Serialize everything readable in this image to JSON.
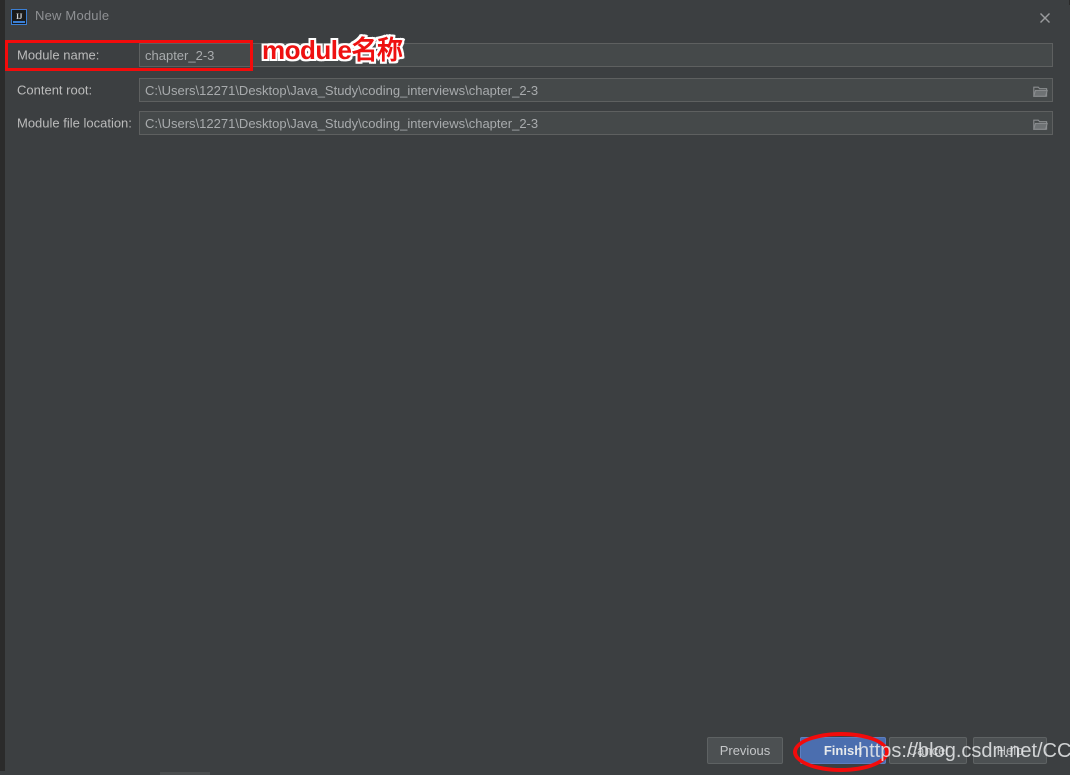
{
  "window": {
    "title": "New Module",
    "app_icon": "intellij-idea-icon",
    "icon_label": "IJ",
    "close_icon": "close-icon"
  },
  "form": {
    "fields": [
      {
        "label": "Module name:",
        "value": "chapter_2-3",
        "has_browse": false,
        "browse_icon": ""
      },
      {
        "label": "Content root:",
        "value": "C:\\Users\\12271\\Desktop\\Java_Study\\coding_interviews\\chapter_2-3",
        "has_browse": true,
        "browse_icon": "folder-icon"
      },
      {
        "label": "Module file location:",
        "value": "C:\\Users\\12271\\Desktop\\Java_Study\\coding_interviews\\chapter_2-3",
        "has_browse": true,
        "browse_icon": "folder-icon"
      }
    ]
  },
  "footer": {
    "buttons": [
      {
        "label": "Previous",
        "primary": false
      },
      {
        "label": "Finish",
        "primary": true
      },
      {
        "label": "Cancel",
        "primary": false
      },
      {
        "label": "Help",
        "primary": false
      }
    ]
  },
  "annotations": {
    "module_name_callout": "module名称",
    "callout_latin": "module",
    "callout_cjk": "名称",
    "highlight_color": "#f30b0b",
    "rect_target": "module-name-row",
    "ellipse_target": "finish-button"
  },
  "watermark": {
    "text": "https://blog.csdn.net/CCsLife"
  },
  "colors": {
    "dialog_background": "#3c3f41",
    "field_background": "#45494a",
    "field_border": "#5e6060",
    "text_primary": "#bbbbbb",
    "text_secondary": "#a8abad",
    "title_text": "#8f9194",
    "primary_button": "#4b6eaf",
    "button_background": "#4c5052",
    "annotation_red": "#f30b0b"
  }
}
